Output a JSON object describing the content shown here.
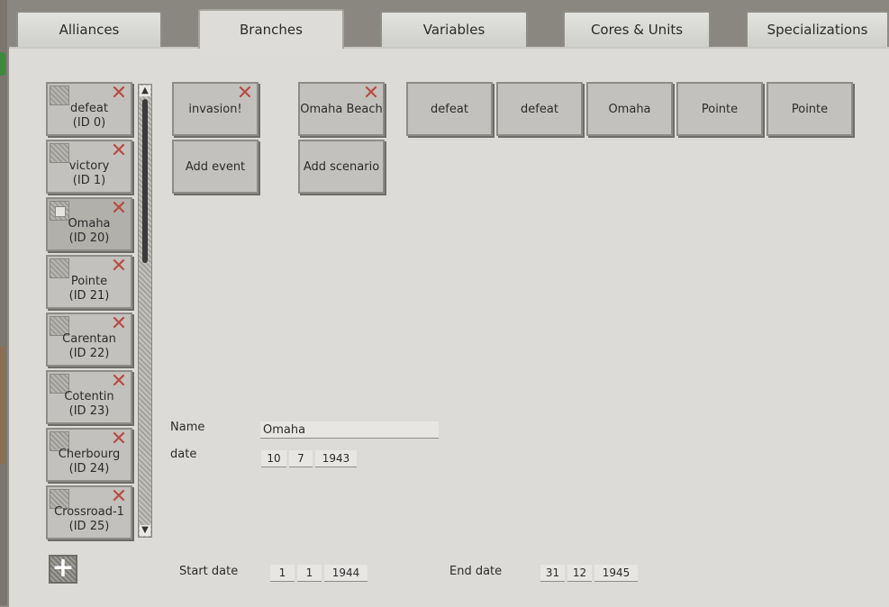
{
  "tabs": [
    {
      "label": "Alliances",
      "active": false
    },
    {
      "label": "Branches",
      "active": true
    },
    {
      "label": "Variables",
      "active": false
    },
    {
      "label": "Cores & Units",
      "active": false
    },
    {
      "label": "Specializations",
      "active": false
    }
  ],
  "branches": [
    {
      "name": "defeat",
      "id_label": "(ID 0)",
      "selected": false
    },
    {
      "name": "victory",
      "id_label": "(ID 1)",
      "selected": false
    },
    {
      "name": "Omaha",
      "id_label": "(ID 20)",
      "selected": true
    },
    {
      "name": "Pointe",
      "id_label": "(ID 21)",
      "selected": false
    },
    {
      "name": "Carentan",
      "id_label": "(ID 22)",
      "selected": false
    },
    {
      "name": "Cotentin",
      "id_label": "(ID 23)",
      "selected": false
    },
    {
      "name": "Cherbourg",
      "id_label": "(ID 24)",
      "selected": false
    },
    {
      "name": "Crossroad-1",
      "id_label": "(ID 25)",
      "selected": false
    }
  ],
  "events": {
    "items": [
      "invasion!"
    ],
    "add_label": "Add event"
  },
  "scenarios": {
    "items": [
      "Omaha Beach"
    ],
    "add_label": "Add scenario"
  },
  "outcomes": [
    "defeat",
    "defeat",
    "Omaha",
    "Pointe",
    "Pointe"
  ],
  "details": {
    "name_label": "Name",
    "name_value": "Omaha",
    "date_label": "date",
    "date": {
      "day": "10",
      "month": "7",
      "year": "1943"
    }
  },
  "campaign": {
    "start_label": "Start date",
    "start": {
      "day": "1",
      "month": "1",
      "year": "1944"
    },
    "end_label": "End date",
    "end": {
      "day": "31",
      "month": "12",
      "year": "1945"
    }
  },
  "colors": {
    "close_x": "#b84b43",
    "panel": "#dcdbd8",
    "button": "#c3c1bd"
  }
}
